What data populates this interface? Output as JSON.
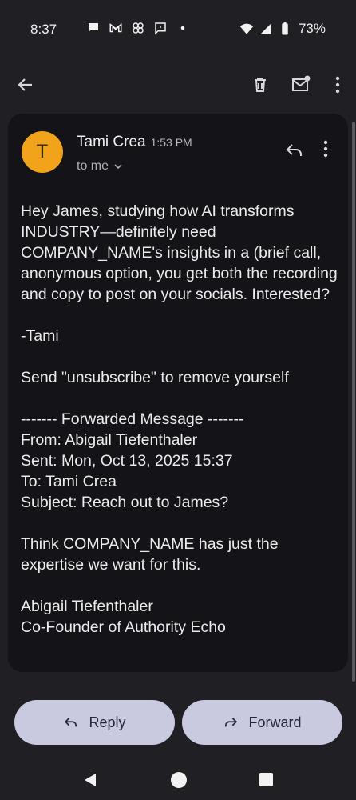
{
  "status_bar": {
    "time": "8:37",
    "battery": "73%",
    "icons_left": [
      "chat-bubble-icon",
      "gmail-icon",
      "pinwheel-icon",
      "message-square-icon",
      "dot-icon"
    ],
    "icons_right": [
      "wifi-icon",
      "signal-icon",
      "battery-icon"
    ]
  },
  "toolbar": {
    "back": "back-arrow-icon",
    "delete": "trash-icon",
    "mark_unread": "mail-unread-icon",
    "more": "more-vert-icon"
  },
  "email": {
    "sender_initial": "T",
    "sender_name": "Tami Crea",
    "time": "1:53 PM",
    "recipient": "to me",
    "body": "Hey James, studying how AI transforms INDUSTRY—definitely need COMPANY_NAME's insights in a (brief call, anonymous option, you get both the recording and copy to post on your socials. Interested?\n\n-Tami\n\nSend \"unsubscribe\" to remove yourself\n\n------- Forwarded Message -------\nFrom: Abigail Tiefenthaler\nSent: Mon, Oct 13, 2025 15:37\nTo: Tami Crea\nSubject: Reach out to James?\n\nThink COMPANY_NAME has just the expertise we want for this.\n\nAbigail Tiefenthaler\nCo-Founder of Authority Echo"
  },
  "actions": {
    "reply_label": "Reply",
    "forward_label": "Forward"
  },
  "colors": {
    "background": "#1f1f24",
    "card": "#141418",
    "avatar": "#f2a31c",
    "pill": "#c9c9e0"
  }
}
